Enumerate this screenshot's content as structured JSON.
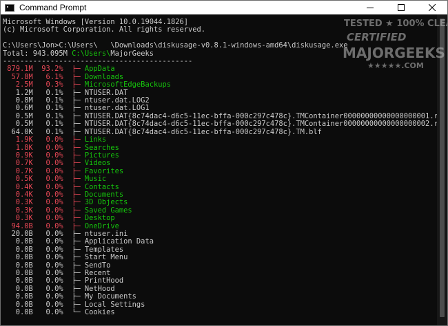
{
  "window": {
    "title": "Command Prompt",
    "icon": "cmd-icon"
  },
  "colors": {
    "console_bg": "#0c0c0c",
    "text_default": "#cccccc",
    "text_red": "#e74856",
    "text_green": "#16c60c"
  },
  "console": {
    "lines": [
      {
        "segments": [
          {
            "text": "Microsoft Windows [Version 10.0.19044.1826]",
            "c": "d"
          }
        ]
      },
      {
        "segments": [
          {
            "text": "(c) Microsoft Corporation. All rights reserved.",
            "c": "d"
          }
        ]
      },
      {
        "segments": [
          {
            "text": "",
            "c": "d"
          }
        ]
      },
      {
        "segments": [
          {
            "text": "C:\\Users\\Jon>C:\\Users\\   \\Downloads\\diskusage-v0.8.1-windows-amd64\\diskusage.exe",
            "c": "d"
          }
        ]
      },
      {
        "segments": [
          {
            "text": "Total: 943.095M ",
            "c": "d"
          },
          {
            "text": "C:\\Users\\",
            "c": "g"
          },
          {
            "text": "MajorGeeks",
            "c": "d"
          }
        ]
      },
      {
        "segments": [
          {
            "text": "--------------------------------------------",
            "c": "d"
          }
        ]
      },
      {
        "segments": [
          {
            "text": " 879.1M  93.2%  ├─ ",
            "c": "r"
          },
          {
            "text": "AppData",
            "c": "g"
          }
        ]
      },
      {
        "segments": [
          {
            "text": "  57.8M   6.1%  ├─ ",
            "c": "r"
          },
          {
            "text": "Downloads",
            "c": "g"
          }
        ]
      },
      {
        "segments": [
          {
            "text": "   2.5M   0.3%  ├─ ",
            "c": "r"
          },
          {
            "text": "MicrosoftEdgeBackups",
            "c": "g"
          }
        ]
      },
      {
        "segments": [
          {
            "text": "   1.2M   0.1%  ├─ NTUSER.DAT",
            "c": "d"
          }
        ]
      },
      {
        "segments": [
          {
            "text": "   0.8M   0.1%  ├─ ntuser.dat.LOG2",
            "c": "d"
          }
        ]
      },
      {
        "segments": [
          {
            "text": "   0.6M   0.1%  ├─ ntuser.dat.LOG1",
            "c": "d"
          }
        ]
      },
      {
        "segments": [
          {
            "text": "   0.5M   0.1%  ├─ NTUSER.DAT{8c74dac4-d6c5-11ec-bffa-000c297c478c}.TMContainer00000000000000000001.regtrans-ms",
            "c": "d"
          }
        ]
      },
      {
        "segments": [
          {
            "text": "   0.5M   0.1%  ├─ NTUSER.DAT{8c74dac4-d6c5-11ec-bffa-000c297c478c}.TMContainer00000000000000000002.regtrans-ms",
            "c": "d"
          }
        ]
      },
      {
        "segments": [
          {
            "text": "  64.0K   0.1%  ├─ NTUSER.DAT{8c74dac4-d6c5-11ec-bffa-000c297c478c}.TM.blf",
            "c": "d"
          }
        ]
      },
      {
        "segments": [
          {
            "text": "   1.9K   0.0%  ├─ ",
            "c": "r"
          },
          {
            "text": "Links",
            "c": "g"
          }
        ]
      },
      {
        "segments": [
          {
            "text": "   1.8K   0.0%  ├─ ",
            "c": "r"
          },
          {
            "text": "Searches",
            "c": "g"
          }
        ]
      },
      {
        "segments": [
          {
            "text": "   0.9K   0.0%  ├─ ",
            "c": "r"
          },
          {
            "text": "Pictures",
            "c": "g"
          }
        ]
      },
      {
        "segments": [
          {
            "text": "   0.7K   0.0%  ├─ ",
            "c": "r"
          },
          {
            "text": "Videos",
            "c": "g"
          }
        ]
      },
      {
        "segments": [
          {
            "text": "   0.7K   0.0%  ├─ ",
            "c": "r"
          },
          {
            "text": "Favorites",
            "c": "g"
          }
        ]
      },
      {
        "segments": [
          {
            "text": "   0.5K   0.0%  ├─ ",
            "c": "r"
          },
          {
            "text": "Music",
            "c": "g"
          }
        ]
      },
      {
        "segments": [
          {
            "text": "   0.4K   0.0%  ├─ ",
            "c": "r"
          },
          {
            "text": "Contacts",
            "c": "g"
          }
        ]
      },
      {
        "segments": [
          {
            "text": "   0.4K   0.0%  ├─ ",
            "c": "r"
          },
          {
            "text": "Documents",
            "c": "g"
          }
        ]
      },
      {
        "segments": [
          {
            "text": "   0.3K   0.0%  ├─ ",
            "c": "r"
          },
          {
            "text": "3D Objects",
            "c": "g"
          }
        ]
      },
      {
        "segments": [
          {
            "text": "   0.3K   0.0%  ├─ ",
            "c": "r"
          },
          {
            "text": "Saved Games",
            "c": "g"
          }
        ]
      },
      {
        "segments": [
          {
            "text": "   0.3K   0.0%  ├─ ",
            "c": "r"
          },
          {
            "text": "Desktop",
            "c": "g"
          }
        ]
      },
      {
        "segments": [
          {
            "text": "  94.0B   0.0%  ├─ ",
            "c": "r"
          },
          {
            "text": "OneDrive",
            "c": "g"
          }
        ]
      },
      {
        "segments": [
          {
            "text": "  20.0B   0.0%  ├─ ntuser.ini",
            "c": "d"
          }
        ]
      },
      {
        "segments": [
          {
            "text": "   0.0B   0.0%  ├─ Application Data",
            "c": "d"
          }
        ]
      },
      {
        "segments": [
          {
            "text": "   0.0B   0.0%  ├─ Templates",
            "c": "d"
          }
        ]
      },
      {
        "segments": [
          {
            "text": "   0.0B   0.0%  ├─ Start Menu",
            "c": "d"
          }
        ]
      },
      {
        "segments": [
          {
            "text": "   0.0B   0.0%  ├─ SendTo",
            "c": "d"
          }
        ]
      },
      {
        "segments": [
          {
            "text": "   0.0B   0.0%  ├─ Recent",
            "c": "d"
          }
        ]
      },
      {
        "segments": [
          {
            "text": "   0.0B   0.0%  ├─ PrintHood",
            "c": "d"
          }
        ]
      },
      {
        "segments": [
          {
            "text": "   0.0B   0.0%  ├─ NetHood",
            "c": "d"
          }
        ]
      },
      {
        "segments": [
          {
            "text": "   0.0B   0.0%  ├─ My Documents",
            "c": "d"
          }
        ]
      },
      {
        "segments": [
          {
            "text": "   0.0B   0.0%  ├─ Local Settings",
            "c": "d"
          }
        ]
      },
      {
        "segments": [
          {
            "text": "   0.0B   0.0%  └─ Cookies",
            "c": "d"
          }
        ]
      }
    ]
  },
  "watermark": {
    "line1": "TESTED ★ 100% CLEAN",
    "line2": "CERTIFIED",
    "line3": "MAJORGEEKS",
    "line4": "★★★★★.COM"
  }
}
